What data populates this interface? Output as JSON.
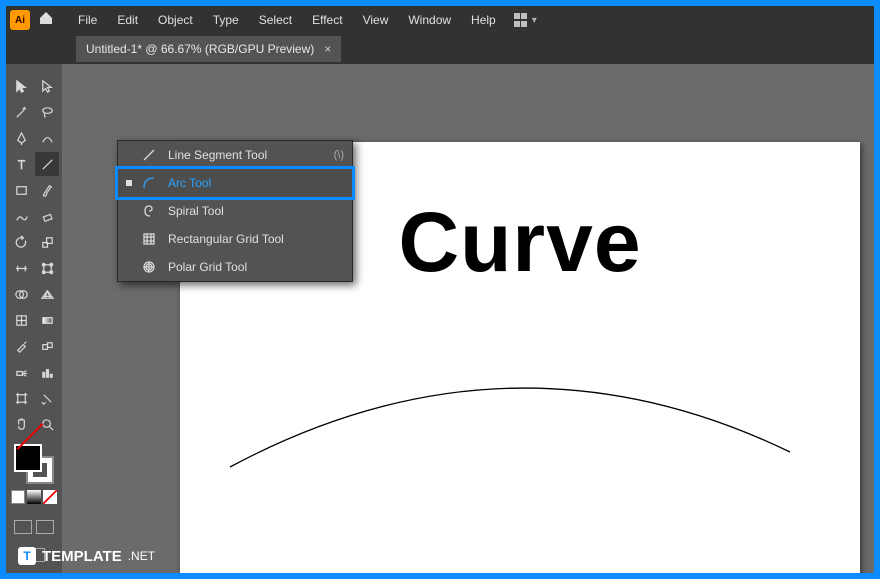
{
  "app": {
    "badge": "Ai"
  },
  "menus": [
    "File",
    "Edit",
    "Object",
    "Type",
    "Select",
    "Effect",
    "View",
    "Window",
    "Help"
  ],
  "tab": {
    "title": "Untitled-1* @ 66.67% (RGB/GPU Preview)"
  },
  "toolbox": {
    "title": ""
  },
  "flyout": {
    "items": [
      {
        "label": "Line Segment Tool",
        "shortcut": "(\\)",
        "icon": "line"
      },
      {
        "label": "Arc Tool",
        "shortcut": "",
        "icon": "arc",
        "selected": true
      },
      {
        "label": "Spiral Tool",
        "shortcut": "",
        "icon": "spiral"
      },
      {
        "label": "Rectangular Grid Tool",
        "shortcut": "",
        "icon": "rectgrid"
      },
      {
        "label": "Polar Grid Tool",
        "shortcut": "",
        "icon": "polargrid"
      }
    ]
  },
  "artboard": {
    "text": "Curve"
  },
  "watermark": {
    "main": "TEMPLATE",
    "suffix": ".NET",
    "icon": "T"
  }
}
